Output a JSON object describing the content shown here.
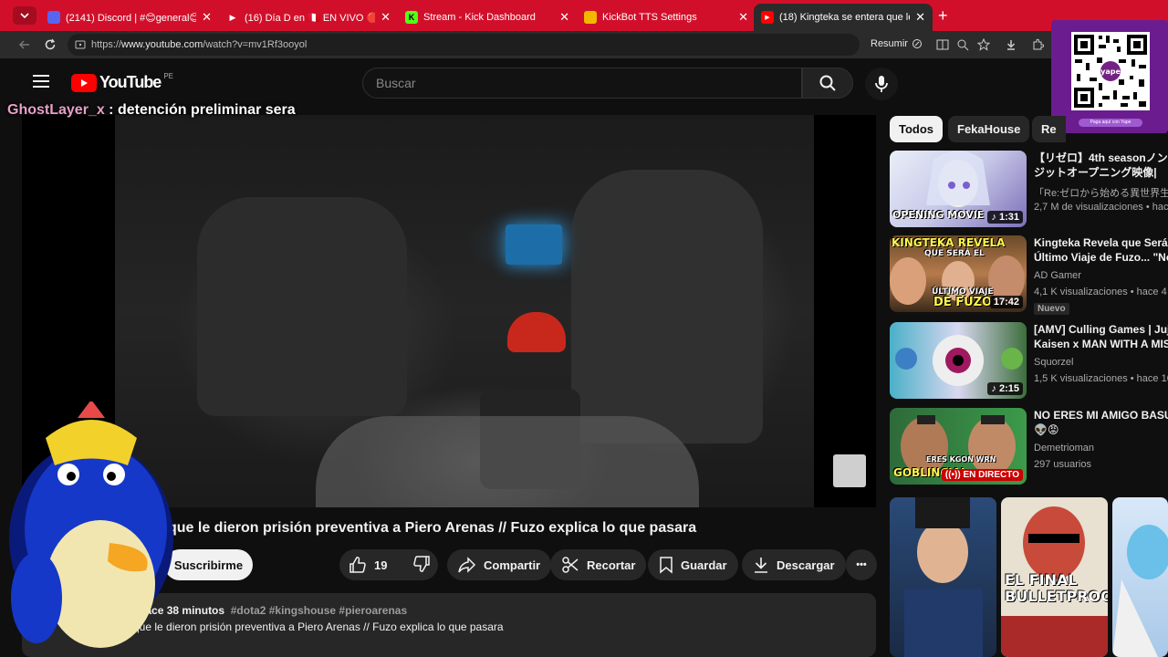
{
  "browser": {
    "tabs": [
      {
        "label": "(2141) Discord | #😊general😊 | 🔖",
        "favicon_color": "#5865f2"
      },
      {
        "label": "(16) Día D en 🇵🇪 EN VIVO 🔴 - Do",
        "favicon_color": "#ff0000"
      },
      {
        "label": "Stream - Kick Dashboard",
        "favicon_color": "#53fc18"
      },
      {
        "label": "KickBot TTS Settings",
        "favicon_color": "#f2b800"
      },
      {
        "label": "(18) Kingteka se entera que le dier",
        "favicon_color": "#ff0000"
      }
    ],
    "url_prefix": "https://",
    "url_host": "www.youtube.com",
    "url_path": "/watch?v=mv1Rf3ooyol",
    "resume_label": "Resumir"
  },
  "qr": {
    "caption": "Paga aquí con Yape",
    "brand": "yape"
  },
  "youtube": {
    "logo_text": "YouTube",
    "region": "PE",
    "search_placeholder": "Buscar"
  },
  "chat": {
    "user": "GhostLayer_x",
    "message": " : detención preliminar sera"
  },
  "video": {
    "title": "que le dieron prisión preventiva a Piero Arenas // Fuzo explica lo que pasara",
    "subscribe_label": "Suscribirme",
    "like_count": "19",
    "share_label": "Compartir",
    "clip_label": "Recortar",
    "save_label": "Guardar",
    "download_label": "Descargar",
    "more_label": "•••"
  },
  "description": {
    "channel_suffix": "es",
    "time_ago": "hace 38 minutos",
    "tags": "#dota2 #kingshouse #pieroarenas",
    "line2": "ra que le dieron prisión preventiva a Piero Arenas // Fuzo explica lo que pasara"
  },
  "chips": [
    "Todos",
    "FekaHouse",
    "Re"
  ],
  "recommendations": [
    {
      "title": "【リゼロ】4th seasonノン",
      "title2": "ジットオープニング映像|",
      "channel": "「Re:ゼロから始める異世界生活",
      "meta": "2,7 M de visualizaciones • hace",
      "duration": "1:31",
      "thumb_text": "OPENING MOVIE"
    },
    {
      "title": "Kingteka Revela que Será e",
      "title2": "Último Viaje de Fuzo... \"No",
      "channel": "AD Gamer",
      "meta": "4,1 K visualizaciones • hace 4 h",
      "duration": "17:42",
      "badge": "Nuevo",
      "thumb_text_top": "KINGTEKA REVELA",
      "thumb_text_mid": "QUE SERÁ EL",
      "thumb_text_bot": "ÚLTIMO VIAJE",
      "thumb_text_bot2": "DE FUZO"
    },
    {
      "title": "[AMV] Culling Games | Juj",
      "title2": "Kaisen x MAN WITH A MIS",
      "channel": "Squorzel",
      "meta": "1,5 K visualizaciones • hace 10",
      "duration": "2:15"
    },
    {
      "title": "NO ERES MI AMIGO BASU",
      "title2": "👽😡",
      "channel": "Demetrioman",
      "meta": "297 usuarios",
      "live": "EN DIRECTO",
      "thumb_text_top": "ERES KGON WRN",
      "thumb_text_bot": "GOBLINCIAI"
    }
  ],
  "shorts": [
    {
      "title": ""
    },
    {
      "title": "EL FINAL BULLETPROOF"
    },
    {
      "title": ""
    }
  ],
  "colors": {
    "tab_bar": "#d20f2a",
    "yt_red": "#ff0000",
    "background": "#0f0f0f"
  }
}
